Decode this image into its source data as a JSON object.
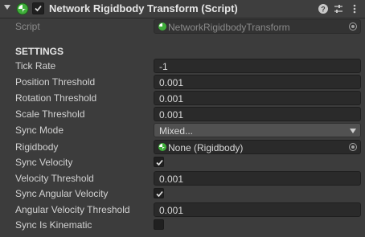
{
  "component": {
    "title": "Network Rigidbody Transform (Script)",
    "script_label": "Script",
    "script_value": "NetworkRigidbodyTransform",
    "enabled": true
  },
  "section": {
    "title": "SETTINGS"
  },
  "fields": {
    "tick_rate": {
      "label": "Tick Rate",
      "value": "-1"
    },
    "position_threshold": {
      "label": "Position Threshold",
      "value": "0.001"
    },
    "rotation_threshold": {
      "label": "Rotation Threshold",
      "value": "0.001"
    },
    "scale_threshold": {
      "label": "Scale Threshold",
      "value": "0.001"
    },
    "sync_mode": {
      "label": "Sync Mode",
      "value": "Mixed..."
    },
    "rigidbody": {
      "label": "Rigidbody",
      "value": "None (Rigidbody)"
    },
    "sync_velocity": {
      "label": "Sync Velocity",
      "checked": true
    },
    "velocity_threshold": {
      "label": "Velocity Threshold",
      "value": "0.001"
    },
    "sync_angular_velocity": {
      "label": "Sync Angular Velocity",
      "checked": true
    },
    "angular_velocity_threshold": {
      "label": "Angular Velocity Threshold",
      "value": "0.001"
    },
    "sync_is_kinematic": {
      "label": "Sync Is Kinematic",
      "checked": false
    }
  },
  "icons": {
    "component": "network-script-icon",
    "help": "help-icon",
    "presets": "presets-sliders-icon",
    "menu": "kebab-menu-icon",
    "object_picker": "object-picker-icon"
  },
  "colors": {
    "background": "#3c3c3c",
    "field": "#2a2a2a",
    "dropdown": "#515151",
    "icon_green": "#3fae3a"
  }
}
